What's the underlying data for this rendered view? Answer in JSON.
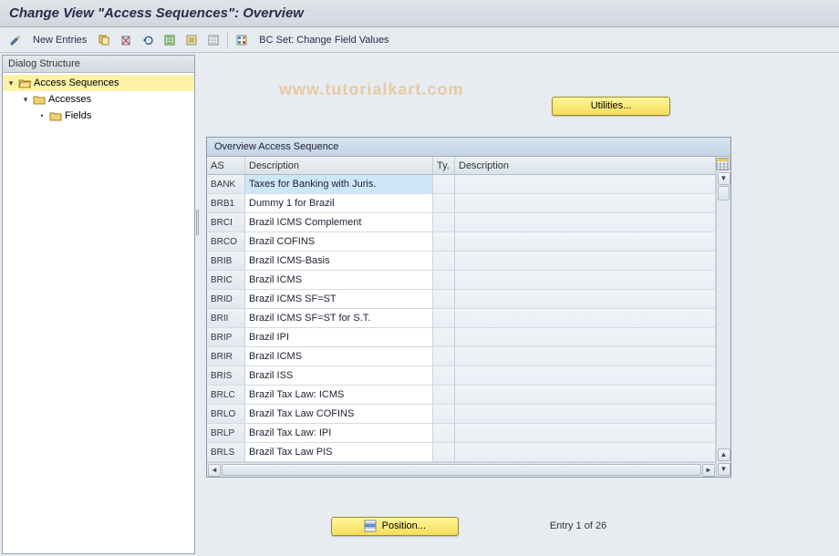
{
  "title": "Change View \"Access Sequences\": Overview",
  "toolbar": {
    "new_entries": "New Entries",
    "bc_set": "BC Set: Change Field Values"
  },
  "dialog_structure": {
    "header": "Dialog Structure",
    "nodes": [
      {
        "label": "Access Sequences",
        "level": 0,
        "expanded": true,
        "selected": true
      },
      {
        "label": "Accesses",
        "level": 1,
        "expanded": true,
        "selected": false
      },
      {
        "label": "Fields",
        "level": 2,
        "expanded": false,
        "selected": false
      }
    ]
  },
  "utilities_label": "Utilities...",
  "table": {
    "title": "Overview Access Sequence",
    "columns": {
      "as": "AS",
      "desc": "Description",
      "ty": "Ty.",
      "desc2": "Description"
    },
    "rows": [
      {
        "as": "BANK",
        "desc": "Taxes for Banking with Juris.",
        "selected": true
      },
      {
        "as": "BRB1",
        "desc": "Dummy 1 for Brazil"
      },
      {
        "as": "BRCI",
        "desc": "Brazil ICMS Complement"
      },
      {
        "as": "BRCO",
        "desc": "Brazil COFINS"
      },
      {
        "as": "BRIB",
        "desc": "Brazil ICMS-Basis"
      },
      {
        "as": "BRIC",
        "desc": "Brazil ICMS"
      },
      {
        "as": "BRID",
        "desc": "Brazil ICMS SF=ST"
      },
      {
        "as": "BRII",
        "desc": "Brazil ICMS SF=ST for S.T."
      },
      {
        "as": "BRIP",
        "desc": "Brazil IPI"
      },
      {
        "as": "BRIR",
        "desc": "Brazil ICMS"
      },
      {
        "as": "BRIS",
        "desc": "Brazil ISS"
      },
      {
        "as": "BRLC",
        "desc": "Brazil Tax Law: ICMS"
      },
      {
        "as": "BRLO",
        "desc": "Brazil Tax Law COFINS"
      },
      {
        "as": "BRLP",
        "desc": "Brazil Tax Law: IPI"
      },
      {
        "as": "BRLS",
        "desc": "Brazil Tax Law PIS"
      }
    ]
  },
  "footer": {
    "position_label": "Position...",
    "entry_text": "Entry 1 of 26"
  },
  "watermark": "www.tutorialkart.com"
}
